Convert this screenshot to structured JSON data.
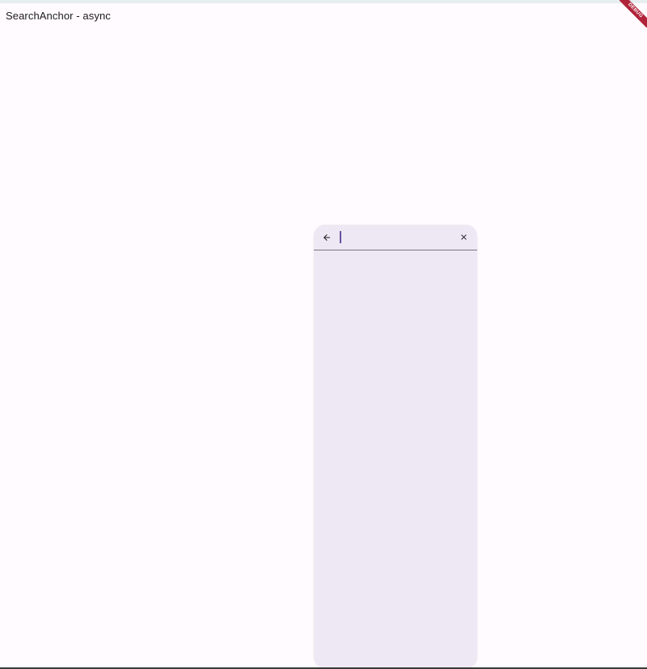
{
  "app": {
    "title": "SearchAnchor - async",
    "debug_banner": "DEBUG"
  },
  "search_view": {
    "query": "",
    "placeholder": "",
    "back_icon": "arrow-back-icon",
    "clear_icon": "close-icon",
    "suggestions": []
  },
  "colors": {
    "background": "#fffbfe",
    "search_surface": "#ede8f3",
    "caret": "#6750a4",
    "debug_ribbon": "#b0243a"
  }
}
